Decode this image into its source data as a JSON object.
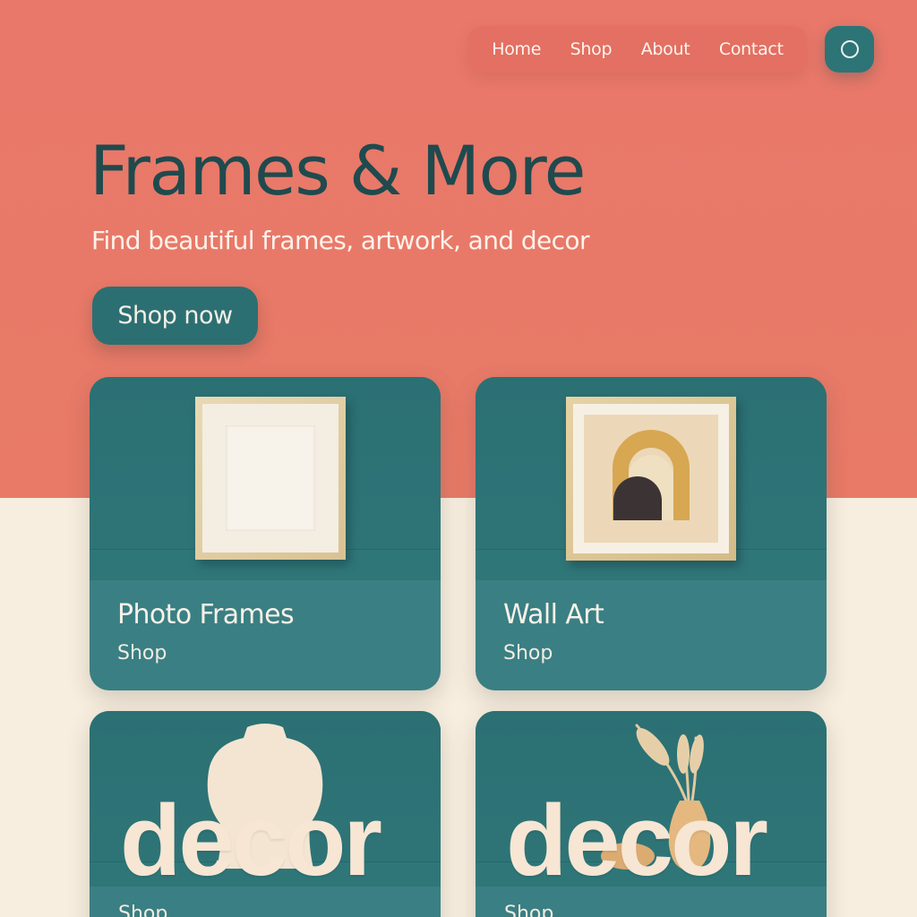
{
  "nav": {
    "items": [
      "Home",
      "Shop",
      "About",
      "Contact"
    ]
  },
  "search": {
    "icon": "search-icon"
  },
  "hero": {
    "title": "Frames & More",
    "subtitle": "Find beautiful frames, artwork, and decor",
    "cta_label": "Shop now"
  },
  "cards": [
    {
      "name": "Photo Frames",
      "link": "Shop"
    },
    {
      "name": "Wall Art",
      "link": "Shop"
    },
    {
      "overlay": "decor",
      "link": "Shop"
    },
    {
      "overlay": "decor",
      "link": "Shop"
    }
  ],
  "colors": {
    "hero_background": "#e9786a",
    "page_background": "#f8eedf",
    "accent_teal": "#2d7476",
    "title_color": "#1f4a4e"
  }
}
